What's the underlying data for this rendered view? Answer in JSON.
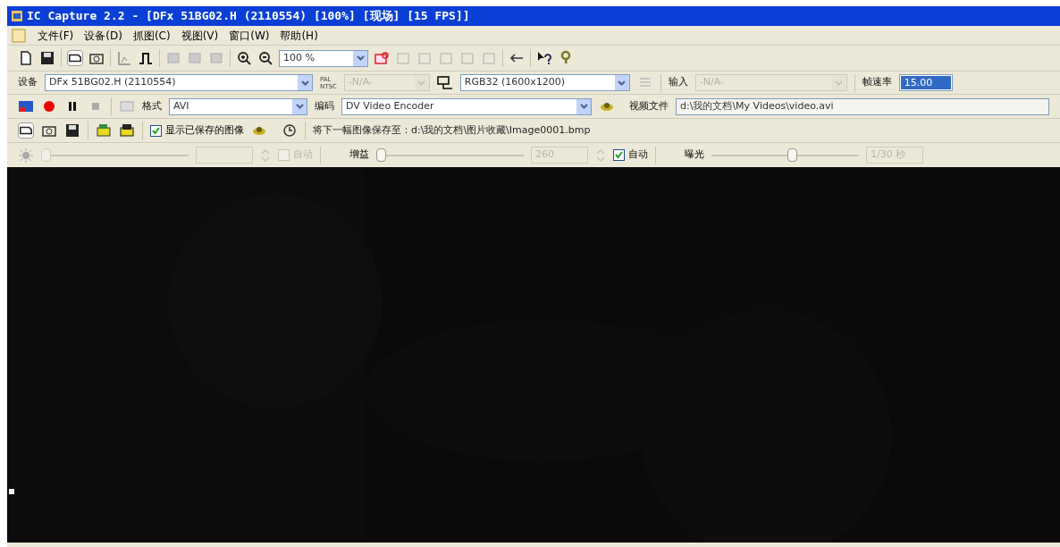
{
  "window": {
    "title": "IC Capture 2.2 - [DFx 51BG02.H (2110554) [100%] [现场] [15 FPS]]"
  },
  "menu": [
    "文件(F)",
    "设备(D)",
    "抓图(C)",
    "视图(V)",
    "窗口(W)",
    "帮助(H)"
  ],
  "toolbar": {
    "zoom": "100 %"
  },
  "device_bar": {
    "device_label": "设备",
    "device": "DFx 51BG02.H (2110554)",
    "norm_labels": [
      "PAL",
      "NTSC"
    ],
    "video_norm": {
      "value": "-N/A-",
      "disabled": true
    },
    "color_format": "RGB32 (1600x1200)",
    "input_label": "输入",
    "input": {
      "value": "-N/A-",
      "disabled": true
    },
    "frame_rate_label": "帧速率",
    "frame_rate": "15.00"
  },
  "capture_bar": {
    "format_label": "格式",
    "format": "AVI",
    "codec_label": "编码",
    "codec": "DV Video Encoder",
    "file_label": "视频文件",
    "file": "d:\\我的文档\\My Videos\\video.avi"
  },
  "snapshot_bar": {
    "show_saved": {
      "label": "显示已保存的图像",
      "checked": true
    },
    "save_to": "将下一幅图像保存至：d:\\我的文档\\图片收藏\\Image0001.bmp"
  },
  "properties": [
    {
      "kind": "brightness",
      "disabled": true,
      "level": 0,
      "value": {
        "disabled": true
      },
      "auto": {
        "label": "自动",
        "checked": false,
        "disabled": true
      }
    },
    {
      "kind": "gain",
      "label": "增益",
      "disabled": false,
      "level": 0,
      "value": {
        "text": "260",
        "disabled": true
      },
      "auto": {
        "label": "自动",
        "checked": true,
        "disabled": false
      }
    },
    {
      "kind": "exposure",
      "label": "曝光",
      "disabled": false,
      "level": 0.55,
      "value": {
        "text": "1/30 秒",
        "disabled": true
      }
    }
  ]
}
